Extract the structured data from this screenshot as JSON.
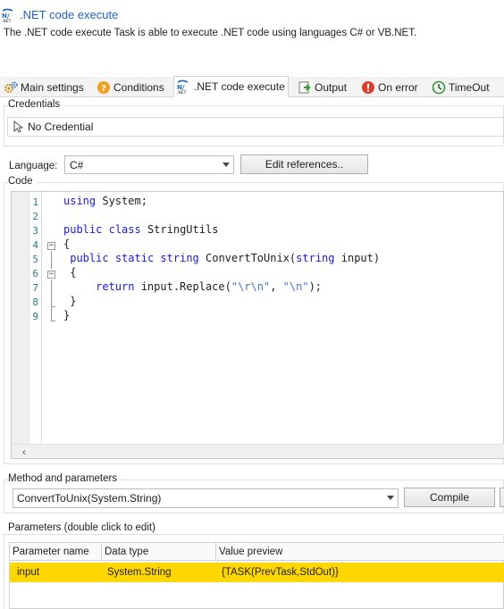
{
  "header": {
    "title": ".NET code execute",
    "description": "The .NET code execute Task is able to execute .NET code using languages C# or VB.NET.",
    "logo_icon": "dotnet-logo-icon"
  },
  "tabs": [
    {
      "label": "Main settings",
      "icon": "gears-icon"
    },
    {
      "label": "Conditions",
      "icon": "question-icon"
    },
    {
      "label": ".NET code execute",
      "icon": "dotnet-logo-icon",
      "active": true
    },
    {
      "label": "Output",
      "icon": "output-icon"
    },
    {
      "label": "On error",
      "icon": "error-icon"
    },
    {
      "label": "TimeOut",
      "icon": "clock-icon"
    }
  ],
  "credentials": {
    "group_label": "Credentials",
    "value": "No Credential"
  },
  "language": {
    "label": "Language:",
    "selected": "C#",
    "edit_references_label": "Edit references.."
  },
  "code": {
    "group_label": "Code",
    "line_numbers": [
      "1",
      "2",
      "3",
      "4",
      "5",
      "6",
      "7",
      "8",
      "9"
    ],
    "lines": [
      [
        {
          "t": "using",
          "k": "kw"
        },
        {
          "t": " System;",
          "k": ""
        }
      ],
      [],
      [
        {
          "t": "public",
          "k": "kw"
        },
        {
          "t": " ",
          "k": ""
        },
        {
          "t": "class",
          "k": "kw"
        },
        {
          "t": " StringUtils",
          "k": ""
        }
      ],
      [
        {
          "t": "{",
          "k": ""
        }
      ],
      [
        {
          "t": " ",
          "k": ""
        },
        {
          "t": "public",
          "k": "kw"
        },
        {
          "t": " ",
          "k": ""
        },
        {
          "t": "static",
          "k": "kw"
        },
        {
          "t": " ",
          "k": ""
        },
        {
          "t": "string",
          "k": "kw"
        },
        {
          "t": " ConvertToUnix(",
          "k": ""
        },
        {
          "t": "string",
          "k": "kw"
        },
        {
          "t": " input)",
          "k": ""
        }
      ],
      [
        {
          "t": " {",
          "k": ""
        }
      ],
      [
        {
          "t": "     ",
          "k": ""
        },
        {
          "t": "return",
          "k": "kw"
        },
        {
          "t": " input.Replace(",
          "k": ""
        },
        {
          "t": "\"\\r\\n\"",
          "k": "str"
        },
        {
          "t": ", ",
          "k": ""
        },
        {
          "t": "\"\\n\"",
          "k": "str"
        },
        {
          "t": ");",
          "k": ""
        }
      ],
      [
        {
          "t": " }",
          "k": ""
        }
      ],
      [
        {
          "t": "}",
          "k": ""
        }
      ]
    ]
  },
  "method": {
    "group_label": "Method and parameters",
    "selected": "ConvertToUnix(System.String)",
    "compile_label": "Compile"
  },
  "parameters": {
    "group_label": "Parameters (double click to edit)",
    "columns": [
      "Parameter name",
      "Data type",
      "Value preview"
    ],
    "rows": [
      [
        "input",
        "System.String",
        "{TASK(PrevTask,StdOut)}"
      ]
    ],
    "selected_row_color": "#ffd700"
  },
  "colors": {
    "accent": "#1d63b8",
    "keyword": "#1a1ad4",
    "string": "#4a73c4"
  }
}
